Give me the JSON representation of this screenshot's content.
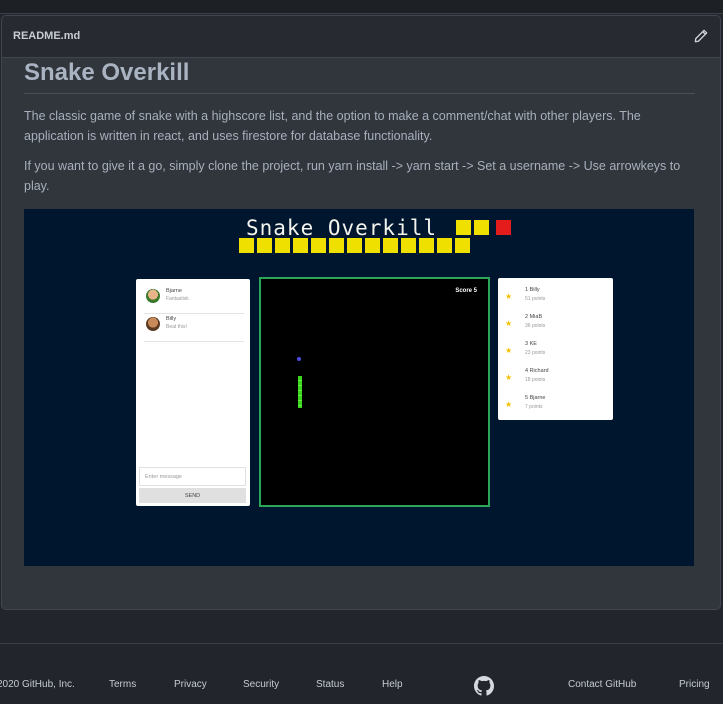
{
  "readme": {
    "filename": "README.md",
    "edit_icon": "pencil-icon",
    "title": "Snake Overkill",
    "paragraph1": "The classic game of snake with a highscore list, and the option to make a comment/chat with other players. The application is written in react, and uses firestore for database functionality.",
    "paragraph2": "If you want to give it a go, simply clone the project, run yarn install -> yarn start -> Set a username -> Use arrowkeys to play."
  },
  "demo": {
    "game_title": "Snake Overkill",
    "colors": {
      "background": "#00152e",
      "snake_yellow": "#f0e000",
      "food_red": "#e51c1c",
      "board_border": "#2aa55a",
      "snake_green": "#3ad81c"
    },
    "chat": {
      "messages": [
        {
          "name": "Bjarne",
          "text": "Fantastisk"
        },
        {
          "name": "Billy",
          "text": "Beat this!"
        }
      ],
      "input_placeholder": "Enter message",
      "send_label": "SEND"
    },
    "score_label": "Score 5",
    "highscores": [
      {
        "rank_name": "1  Billy",
        "points": "51 points"
      },
      {
        "rank_name": "2  MiaB",
        "points": "36 points"
      },
      {
        "rank_name": "3  KE",
        "points": "23 points"
      },
      {
        "rank_name": "4  Richard",
        "points": "18 points"
      },
      {
        "rank_name": "5  Bjarne",
        "points": "7 points"
      }
    ]
  },
  "footer": {
    "copyright": "2020 GitHub, Inc.",
    "links": [
      "Terms",
      "Privacy",
      "Security",
      "Status",
      "Help",
      "Contact GitHub",
      "Pricing"
    ],
    "logo_icon": "github-icon"
  }
}
